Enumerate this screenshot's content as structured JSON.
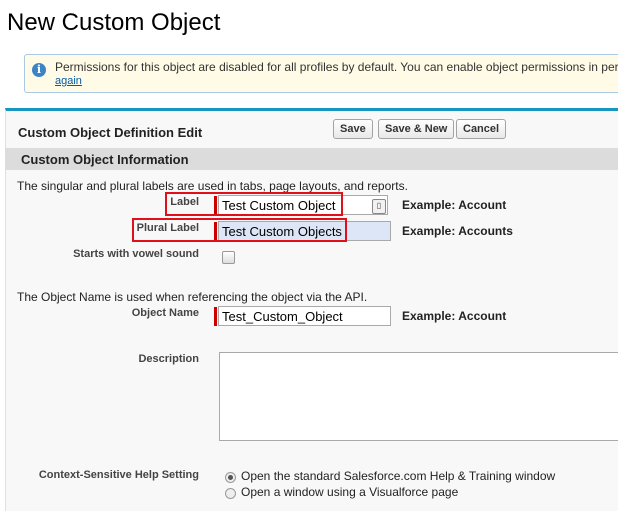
{
  "page": {
    "title": "New Custom Object"
  },
  "info": {
    "text": "Permissions for this object are disabled for all profiles by default. You can enable object permissions in per",
    "link": "again"
  },
  "panel": {
    "title": "Custom Object Definition Edit",
    "buttons": {
      "save": "Save",
      "save_new": "Save & New",
      "cancel": "Cancel"
    }
  },
  "section": {
    "title": "Custom Object Information",
    "desc1": "The singular and plural labels are used in tabs, page layouts, and reports.",
    "desc2": "The Object Name is used when referencing the object via the API."
  },
  "fields": {
    "label": {
      "label": "Label",
      "value": "Test Custom Object",
      "example": "Example:  Account"
    },
    "plural": {
      "label": "Plural Label",
      "value": "Test Custom Objects",
      "example": "Example:  Accounts"
    },
    "vowel": {
      "label": "Starts with vowel sound",
      "checked": false
    },
    "object_name": {
      "label": "Object Name",
      "value": "Test_Custom_Object",
      "example": "Example:  Account"
    },
    "description": {
      "label": "Description",
      "value": ""
    },
    "help": {
      "label": "Context-Sensitive Help Setting",
      "option1": "Open the standard Salesforce.com Help & Training window",
      "option2": "Open a window using a Visualforce page",
      "selected": "option1"
    }
  },
  "colors": {
    "accent": "#1797c0",
    "highlight": "#e0101a",
    "required": "#cc0000",
    "link": "#015ba7"
  }
}
